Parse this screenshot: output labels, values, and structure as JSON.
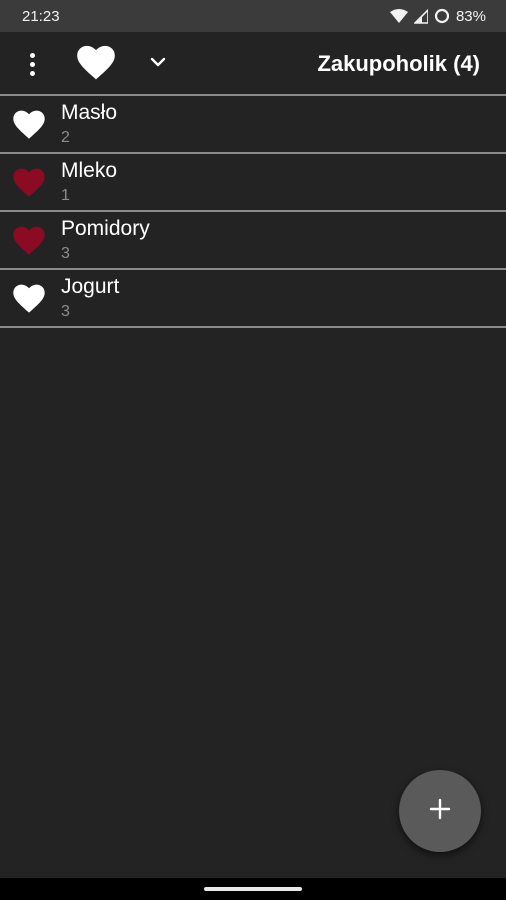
{
  "status_bar": {
    "time": "21:23",
    "battery": "83%",
    "icons": [
      "wifi-icon",
      "signal-icon",
      "battery-icon"
    ]
  },
  "toolbar": {
    "menu_icon": "more-vert-icon",
    "favorite_icon": "heart-icon",
    "dropdown_icon": "chevron-down-icon",
    "title": "Zakupoholik (4)"
  },
  "items": [
    {
      "name": "Masło",
      "quantity": "2",
      "favorite": false,
      "heart_color": "#ffffff"
    },
    {
      "name": "Mleko",
      "quantity": "1",
      "favorite": true,
      "heart_color": "#8b0a24"
    },
    {
      "name": "Pomidory",
      "quantity": "3",
      "favorite": true,
      "heart_color": "#8b0a24"
    },
    {
      "name": "Jogurt",
      "quantity": "3",
      "favorite": false,
      "heart_color": "#ffffff"
    }
  ],
  "fab": {
    "icon": "plus-icon",
    "label": "+"
  },
  "colors": {
    "background": "#232323",
    "status_bar": "#3b3b3b",
    "favorite_heart": "#8b0a24",
    "fab": "#5a5a5a"
  }
}
